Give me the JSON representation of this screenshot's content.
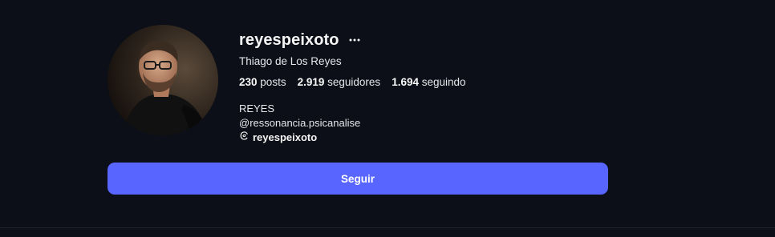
{
  "profile": {
    "username": "reyespeixoto",
    "full_name": "Thiago de Los Reyes",
    "stats": {
      "posts_count": "230",
      "posts_label": "posts",
      "followers_count": "2.919",
      "followers_label": "seguidores",
      "following_count": "1.694",
      "following_label": "seguindo"
    },
    "bio": {
      "line1": "REYES",
      "line2": "@ressonancia.psicanalise",
      "threads_handle": "reyespeixoto"
    }
  },
  "actions": {
    "follow_label": "Seguir"
  },
  "colors": {
    "background": "#0c0f17",
    "accent": "#5865ff"
  },
  "icons": {
    "more": "more-options-icon",
    "threads": "threads-icon"
  }
}
